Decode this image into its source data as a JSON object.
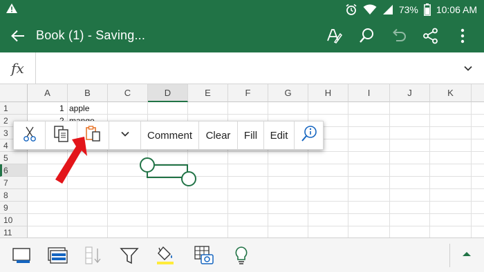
{
  "status_bar": {
    "battery": "73%",
    "time": "10:06 AM",
    "icons": [
      "warning-icon",
      "alarm-icon",
      "wifi-icon",
      "signal-icon",
      "battery-icon"
    ]
  },
  "title_bar": {
    "title": "Book (1) - Saving...",
    "icons": [
      "back-arrow-icon",
      "draw-pen-icon",
      "search-icon",
      "undo-icon",
      "share-icon",
      "more-vert-icon"
    ]
  },
  "formula_bar": {
    "fx_label": "fx",
    "value": ""
  },
  "grid": {
    "columns": [
      "A",
      "B",
      "C",
      "D",
      "E",
      "F",
      "G",
      "H",
      "I",
      "J",
      "K"
    ],
    "selected_column": "D",
    "rows": [
      "1",
      "2",
      "3",
      "4",
      "5",
      "6",
      "7",
      "8",
      "9",
      "10",
      "11"
    ],
    "selected_row": "6",
    "cells": [
      {
        "ref": "B1",
        "value": "1",
        "label": "apple"
      },
      {
        "ref": "B2",
        "value": "2",
        "label": "mango"
      }
    ]
  },
  "context_menu": {
    "icons": [
      "cut-icon",
      "copy-icon",
      "paste-icon",
      "chevron-down-icon",
      "smart-lookup-icon"
    ],
    "labels": {
      "comment": "Comment",
      "clear": "Clear",
      "fill": "Fill",
      "edit": "Edit"
    }
  },
  "bottom_toolbar": {
    "icons": [
      "freeze-panes-icon",
      "wrap-icon",
      "sort-icon",
      "filter-icon",
      "fill-color-icon",
      "insert-picture-icon",
      "tell-me-lightbulb-icon",
      "expand-up-icon"
    ],
    "accent_color": "#217346",
    "fill_color_swatch": "#ffeb3b"
  },
  "annotation": {
    "arrow_color": "#e3151a"
  }
}
